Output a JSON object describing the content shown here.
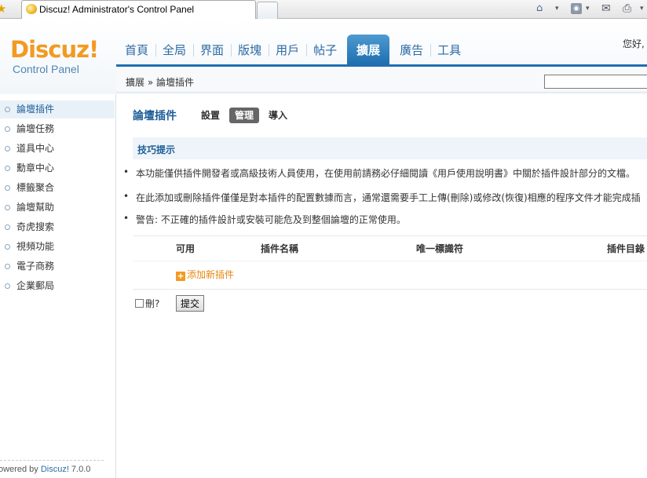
{
  "browser": {
    "tab_title": "Discuz! Administrator's Control Panel"
  },
  "header": {
    "logo": "Discuz!",
    "logo_sub": "Control Panel",
    "greeting": "您好,",
    "nav": [
      "首頁",
      "全局",
      "界面",
      "版塊",
      "用戶",
      "帖子",
      "擴展",
      "廣告",
      "工具"
    ],
    "active_nav_index": 6
  },
  "breadcrumb": "擴展 » 論壇插件",
  "sidebar": {
    "items": [
      "論壇插件",
      "論壇任務",
      "道具中心",
      "勳章中心",
      "標籤聚合",
      "論壇幫助",
      "奇虎搜索",
      "視頻功能",
      "電子商務",
      "企業郵局"
    ],
    "active_index": 0,
    "footer_prefix": "owered by ",
    "footer_brand": "Discuz!",
    "footer_version": " 7.0.0"
  },
  "main": {
    "title": "論壇插件",
    "subtabs": [
      "設置",
      "管理",
      "導入"
    ],
    "active_subtab": 1,
    "tips_title": "技巧提示",
    "tips": [
      "本功能僅供插件開發者或高級技術人員使用，在使用前請務必仔細閱讀《用戶使用說明書》中關於插件設計部分的文檔。",
      "在此添加或刪除插件僅僅是對本插件的配置數據而言，通常還需要手工上傳(刪除)或修改(恢復)相應的程序文件才能完成插",
      "警告: 不正確的插件設計或安裝可能危及到整個論壇的正常使用。"
    ],
    "columns": [
      "可用",
      "插件名稱",
      "唯一標識符",
      "插件目錄"
    ],
    "add_label": "添加新插件",
    "delete_label": "刪?",
    "submit_label": "提交"
  },
  "colors": {
    "accent": "#1f6fb0",
    "logo_orange": "#f29a21",
    "add_orange": "#e8850f"
  }
}
